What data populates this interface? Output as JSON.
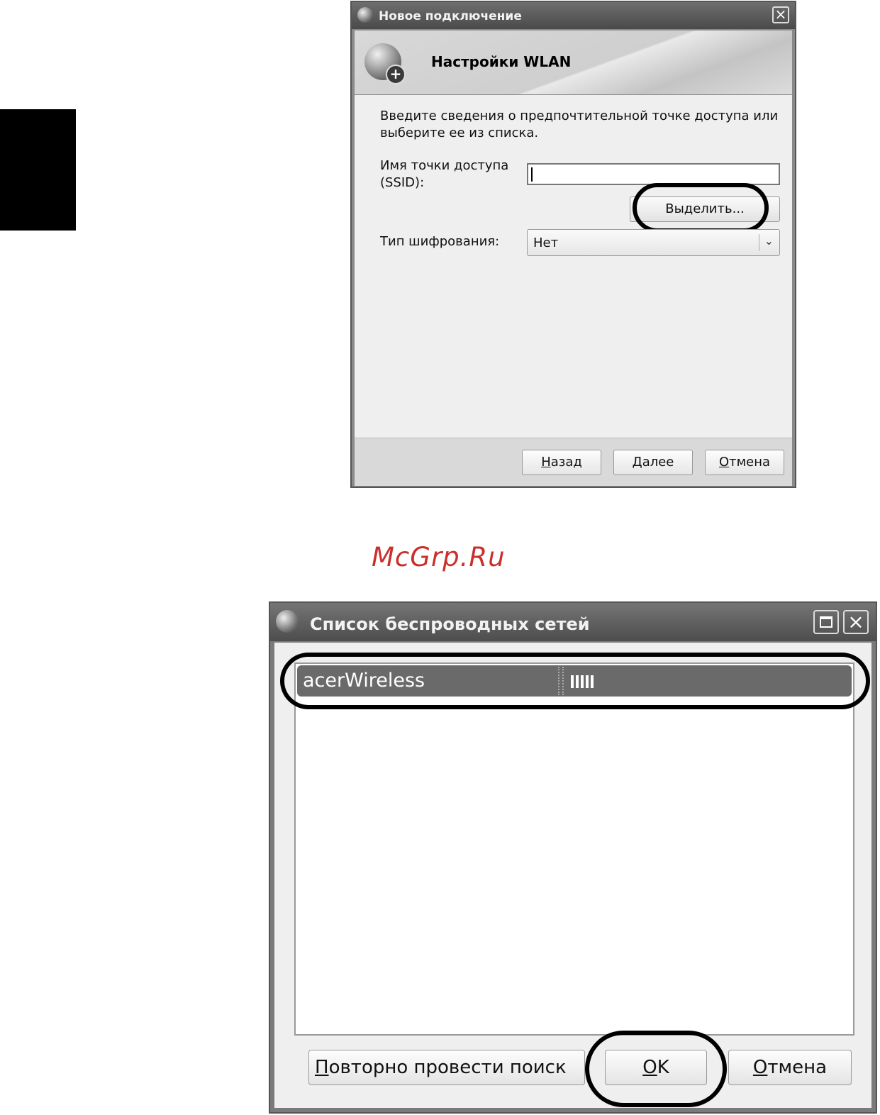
{
  "dialog1": {
    "title": "Новое подключение",
    "header_title": "Настройки WLAN",
    "intro": "Введите сведения о предпочтительной точке доступа или выберите ее из списка.",
    "ssid_label": "Имя точки доступа (SSID):",
    "ssid_value": "",
    "select_button": "Выделить...",
    "encryption_label": "Тип шифрования:",
    "encryption_value": "Нет",
    "buttons": {
      "back_ul": "Н",
      "back_rest": "азад",
      "next_ul": "Д",
      "next_rest": "алее",
      "cancel_ul": "О",
      "cancel_rest": "тмена"
    }
  },
  "watermark": "McGrp.Ru",
  "dialog2": {
    "title": "Список беспроводных сетей",
    "networks": [
      {
        "name": "acerWireless",
        "signal_bars": 5
      }
    ],
    "buttons": {
      "rescan_ul": "П",
      "rescan_rest": "овторно провести поиск",
      "ok_ul": "O",
      "ok_rest": "K",
      "cancel_ul": "О",
      "cancel_rest": "тмена"
    }
  }
}
